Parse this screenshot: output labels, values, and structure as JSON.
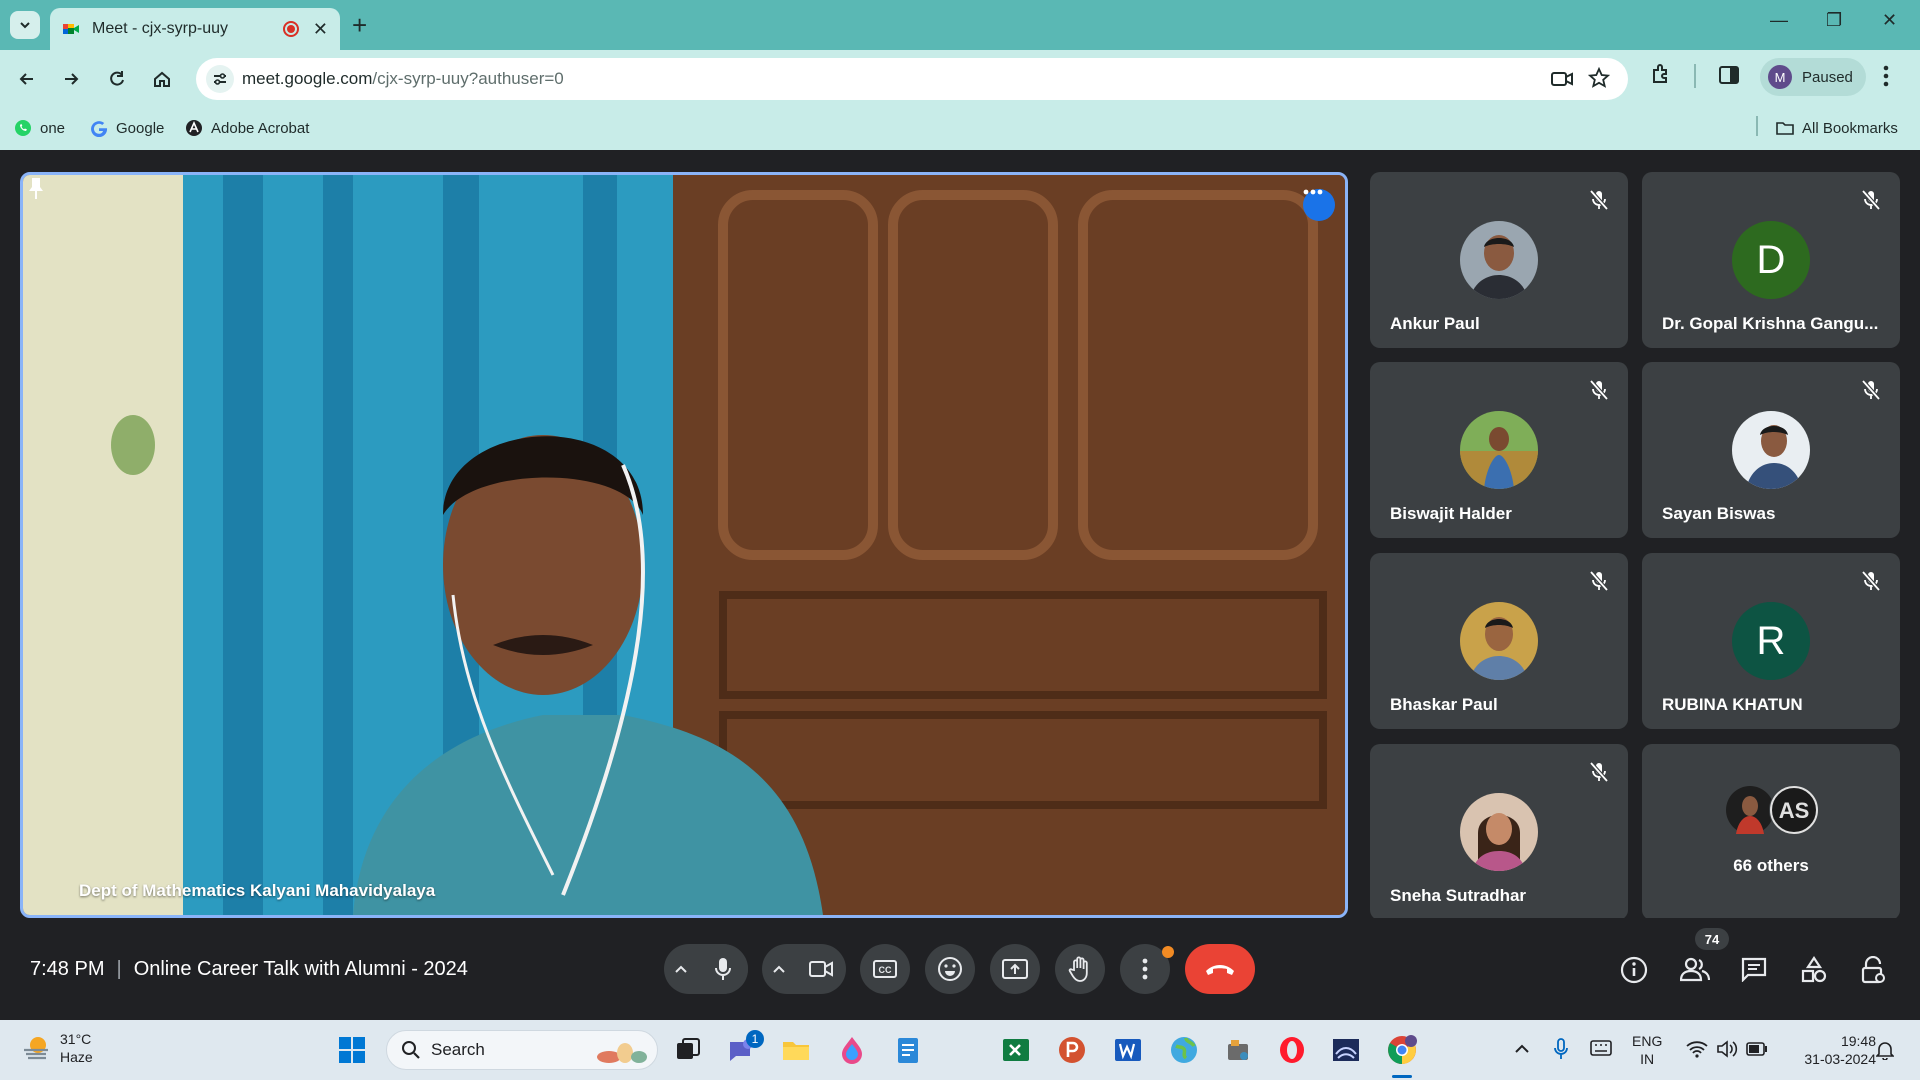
{
  "browser": {
    "tab_title": "Meet - cjx-syrp-uuy",
    "url_main": "meet.google.com",
    "url_rest": "/cjx-syrp-uuy?authuser=0",
    "profile_initial": "M",
    "profile_status": "Paused",
    "bookmarks": [
      {
        "label": "one",
        "icon": "whatsapp-icon"
      },
      {
        "label": "Google",
        "icon": "google-icon"
      },
      {
        "label": "Adobe Acrobat",
        "icon": "acrobat-icon"
      }
    ],
    "all_bookmarks": "All Bookmarks"
  },
  "meet": {
    "main_speaker": "Dept of Mathematics Kalyani Mahavidyalaya",
    "participants": [
      {
        "name": "Ankur Paul",
        "type": "photo",
        "muted": true
      },
      {
        "name": "Dr. Gopal Krishna Gangu...",
        "type": "initial",
        "initial": "D",
        "color": "#2d6a1f",
        "muted": true
      },
      {
        "name": "Biswajit Halder",
        "type": "photo",
        "muted": true
      },
      {
        "name": "Sayan Biswas",
        "type": "photo",
        "muted": true
      },
      {
        "name": "Bhaskar Paul",
        "type": "photo",
        "muted": true
      },
      {
        "name": "RUBINA KHATUN",
        "type": "initial",
        "initial": "R",
        "color": "#0d5443",
        "muted": true
      },
      {
        "name": "Sneha Sutradhar",
        "type": "photo",
        "muted": true
      }
    ],
    "others_label": "66 others",
    "time": "7:48 PM",
    "meeting_title": "Online Career Talk with Alumni - 2024",
    "people_count": "74"
  },
  "taskbar": {
    "temperature": "31°C",
    "weather": "Haze",
    "search": "Search",
    "chat_badge": "1",
    "lang_top": "ENG",
    "lang_bottom": "IN",
    "clock_time": "19:48",
    "clock_date": "31-03-2024"
  },
  "colors": {
    "accent": "#1a73e8",
    "end_call": "#ea4335",
    "tile_bg": "#3c4043",
    "stage_bg": "#202124",
    "chrome_tab": "#5ab8b4"
  }
}
